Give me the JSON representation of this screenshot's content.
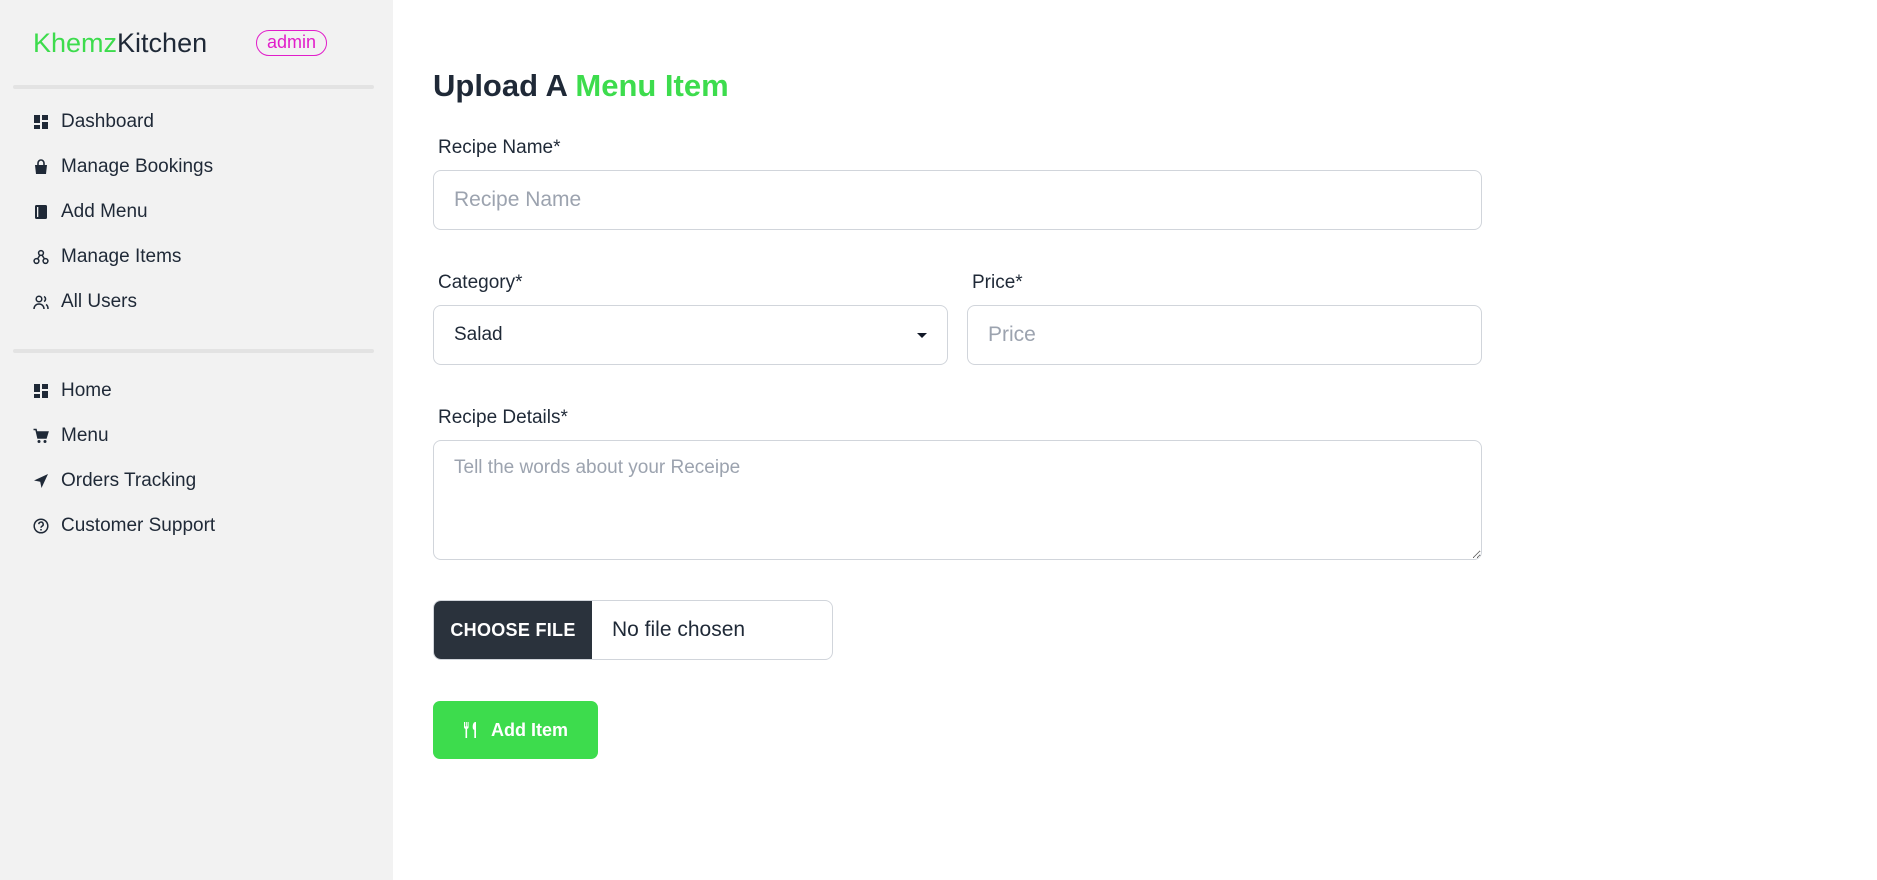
{
  "brand": {
    "prefix": "Khemz",
    "suffix": "Kitchen",
    "role_badge": "admin"
  },
  "colors": {
    "accent": "#3ddc4d",
    "badge": "#e11dca",
    "dark_button": "#2a323c",
    "sidebar_bg": "#f2f2f2"
  },
  "sidebar": {
    "admin_items": [
      {
        "label": "Dashboard",
        "icon": "dashboard-icon"
      },
      {
        "label": "Manage Bookings",
        "icon": "shopping-bag-icon"
      },
      {
        "label": "Add Menu",
        "icon": "book-icon"
      },
      {
        "label": "Manage Items",
        "icon": "hierarchy-icon"
      },
      {
        "label": "All Users",
        "icon": "users-icon"
      }
    ],
    "public_items": [
      {
        "label": "Home",
        "icon": "dashboard-icon"
      },
      {
        "label": "Menu",
        "icon": "cart-icon"
      },
      {
        "label": "Orders Tracking",
        "icon": "location-arrow-icon"
      },
      {
        "label": "Customer Support",
        "icon": "question-circle-icon"
      }
    ]
  },
  "form": {
    "title_prefix": "Upload A",
    "title_accent": "Menu Item",
    "recipe_name": {
      "label": "Recipe Name*",
      "placeholder": "Recipe Name",
      "value": ""
    },
    "category": {
      "label": "Category*",
      "selected": "Salad"
    },
    "price": {
      "label": "Price*",
      "placeholder": "Price",
      "value": ""
    },
    "details": {
      "label": "Recipe Details*",
      "placeholder": "Tell the words about your Receipe"
    },
    "file": {
      "button_label": "CHOOSE FILE",
      "status": "No file chosen"
    },
    "submit": {
      "label": "Add Item",
      "icon": "utensils-icon"
    }
  }
}
